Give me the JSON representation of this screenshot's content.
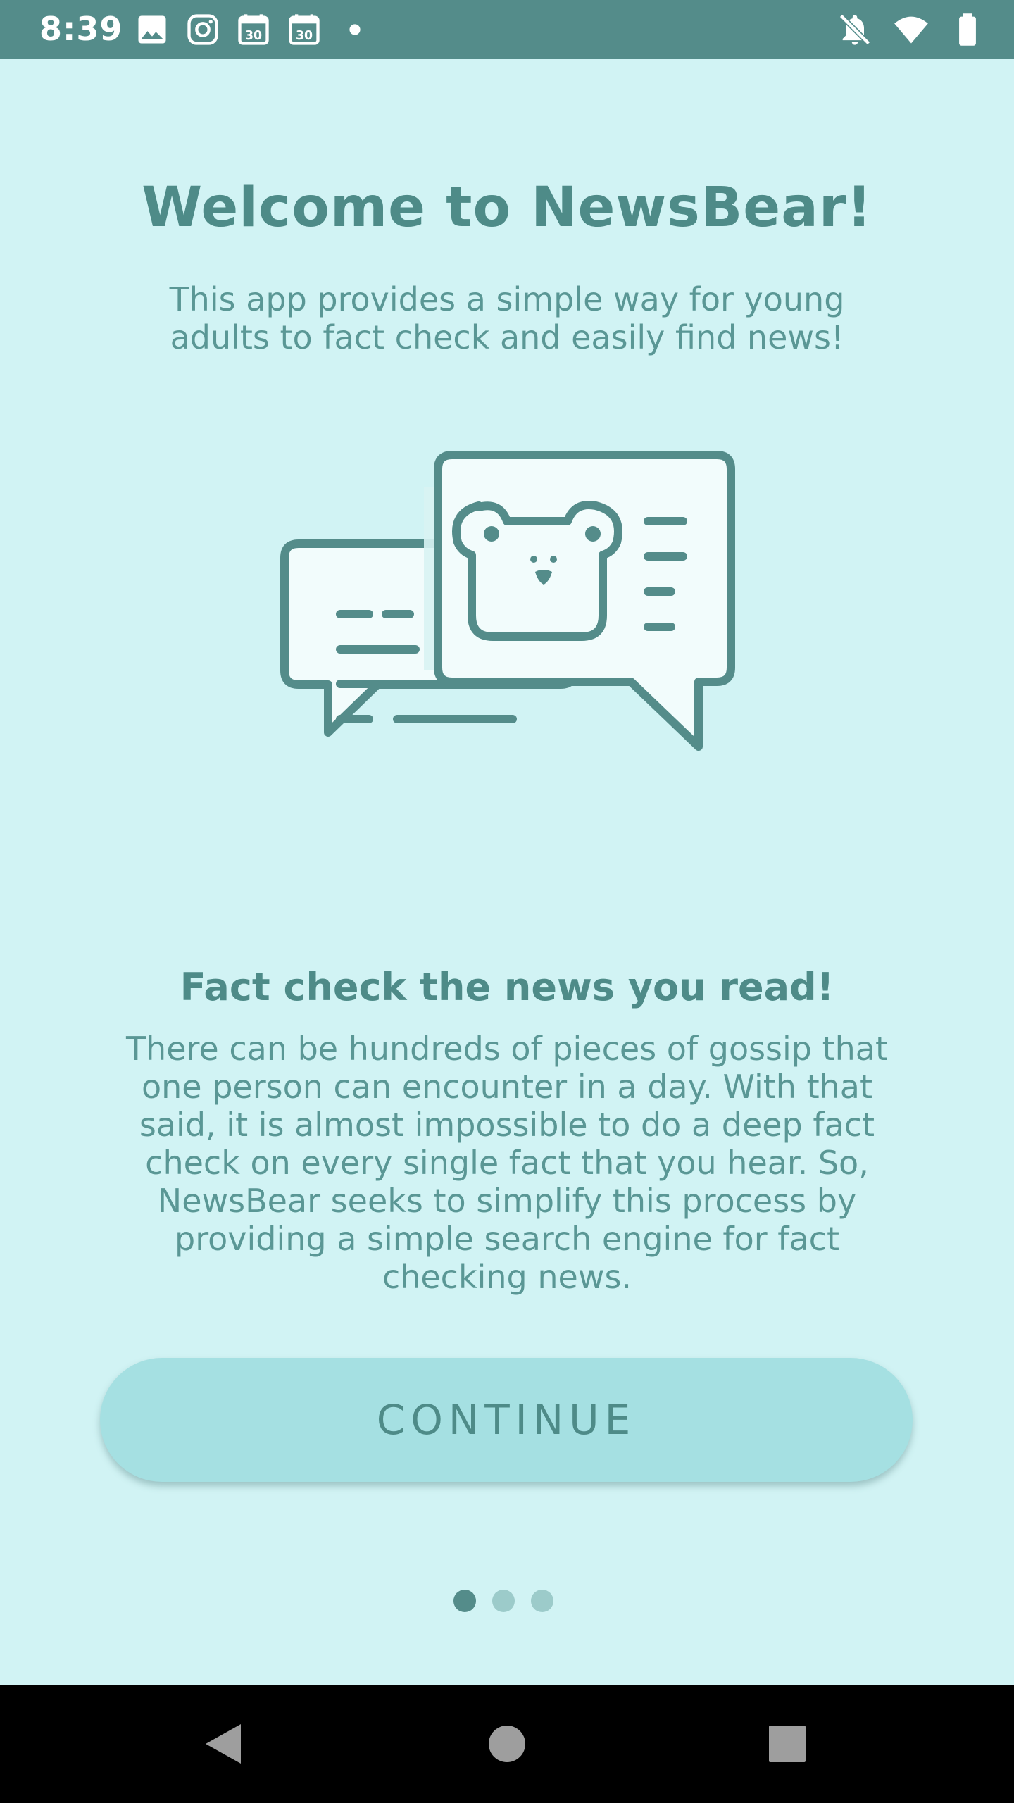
{
  "status_bar": {
    "time": "8:39",
    "left_icons": [
      "image-icon",
      "instagram-icon",
      "calendar-30-icon",
      "calendar-30-icon",
      "dot-icon"
    ],
    "right_icons": [
      "notifications-off-icon",
      "wifi-icon",
      "battery-icon"
    ],
    "calendar_day": "30"
  },
  "welcome": {
    "title": "Welcome to NewsBear!",
    "subtitle": "This app provides a simple way for young adults to fact check and easily find news!"
  },
  "feature": {
    "title": "Fact check the news you read!",
    "body": "There can be hundreds of pieces of gossip that one person can encounter in a day. With that said, it is almost impossible to do a deep fact check on every single fact that you hear. So, NewsBear seeks to simplify this process by providing a simple search engine for fact checking news."
  },
  "continue_button": {
    "label": "CONTINUE"
  },
  "pager": {
    "total": 3,
    "current": 1
  },
  "colors": {
    "background": "#d1f3f4",
    "status_bar": "#548c8a",
    "accent": "#4e8b88",
    "button": "#a5e0e2"
  }
}
